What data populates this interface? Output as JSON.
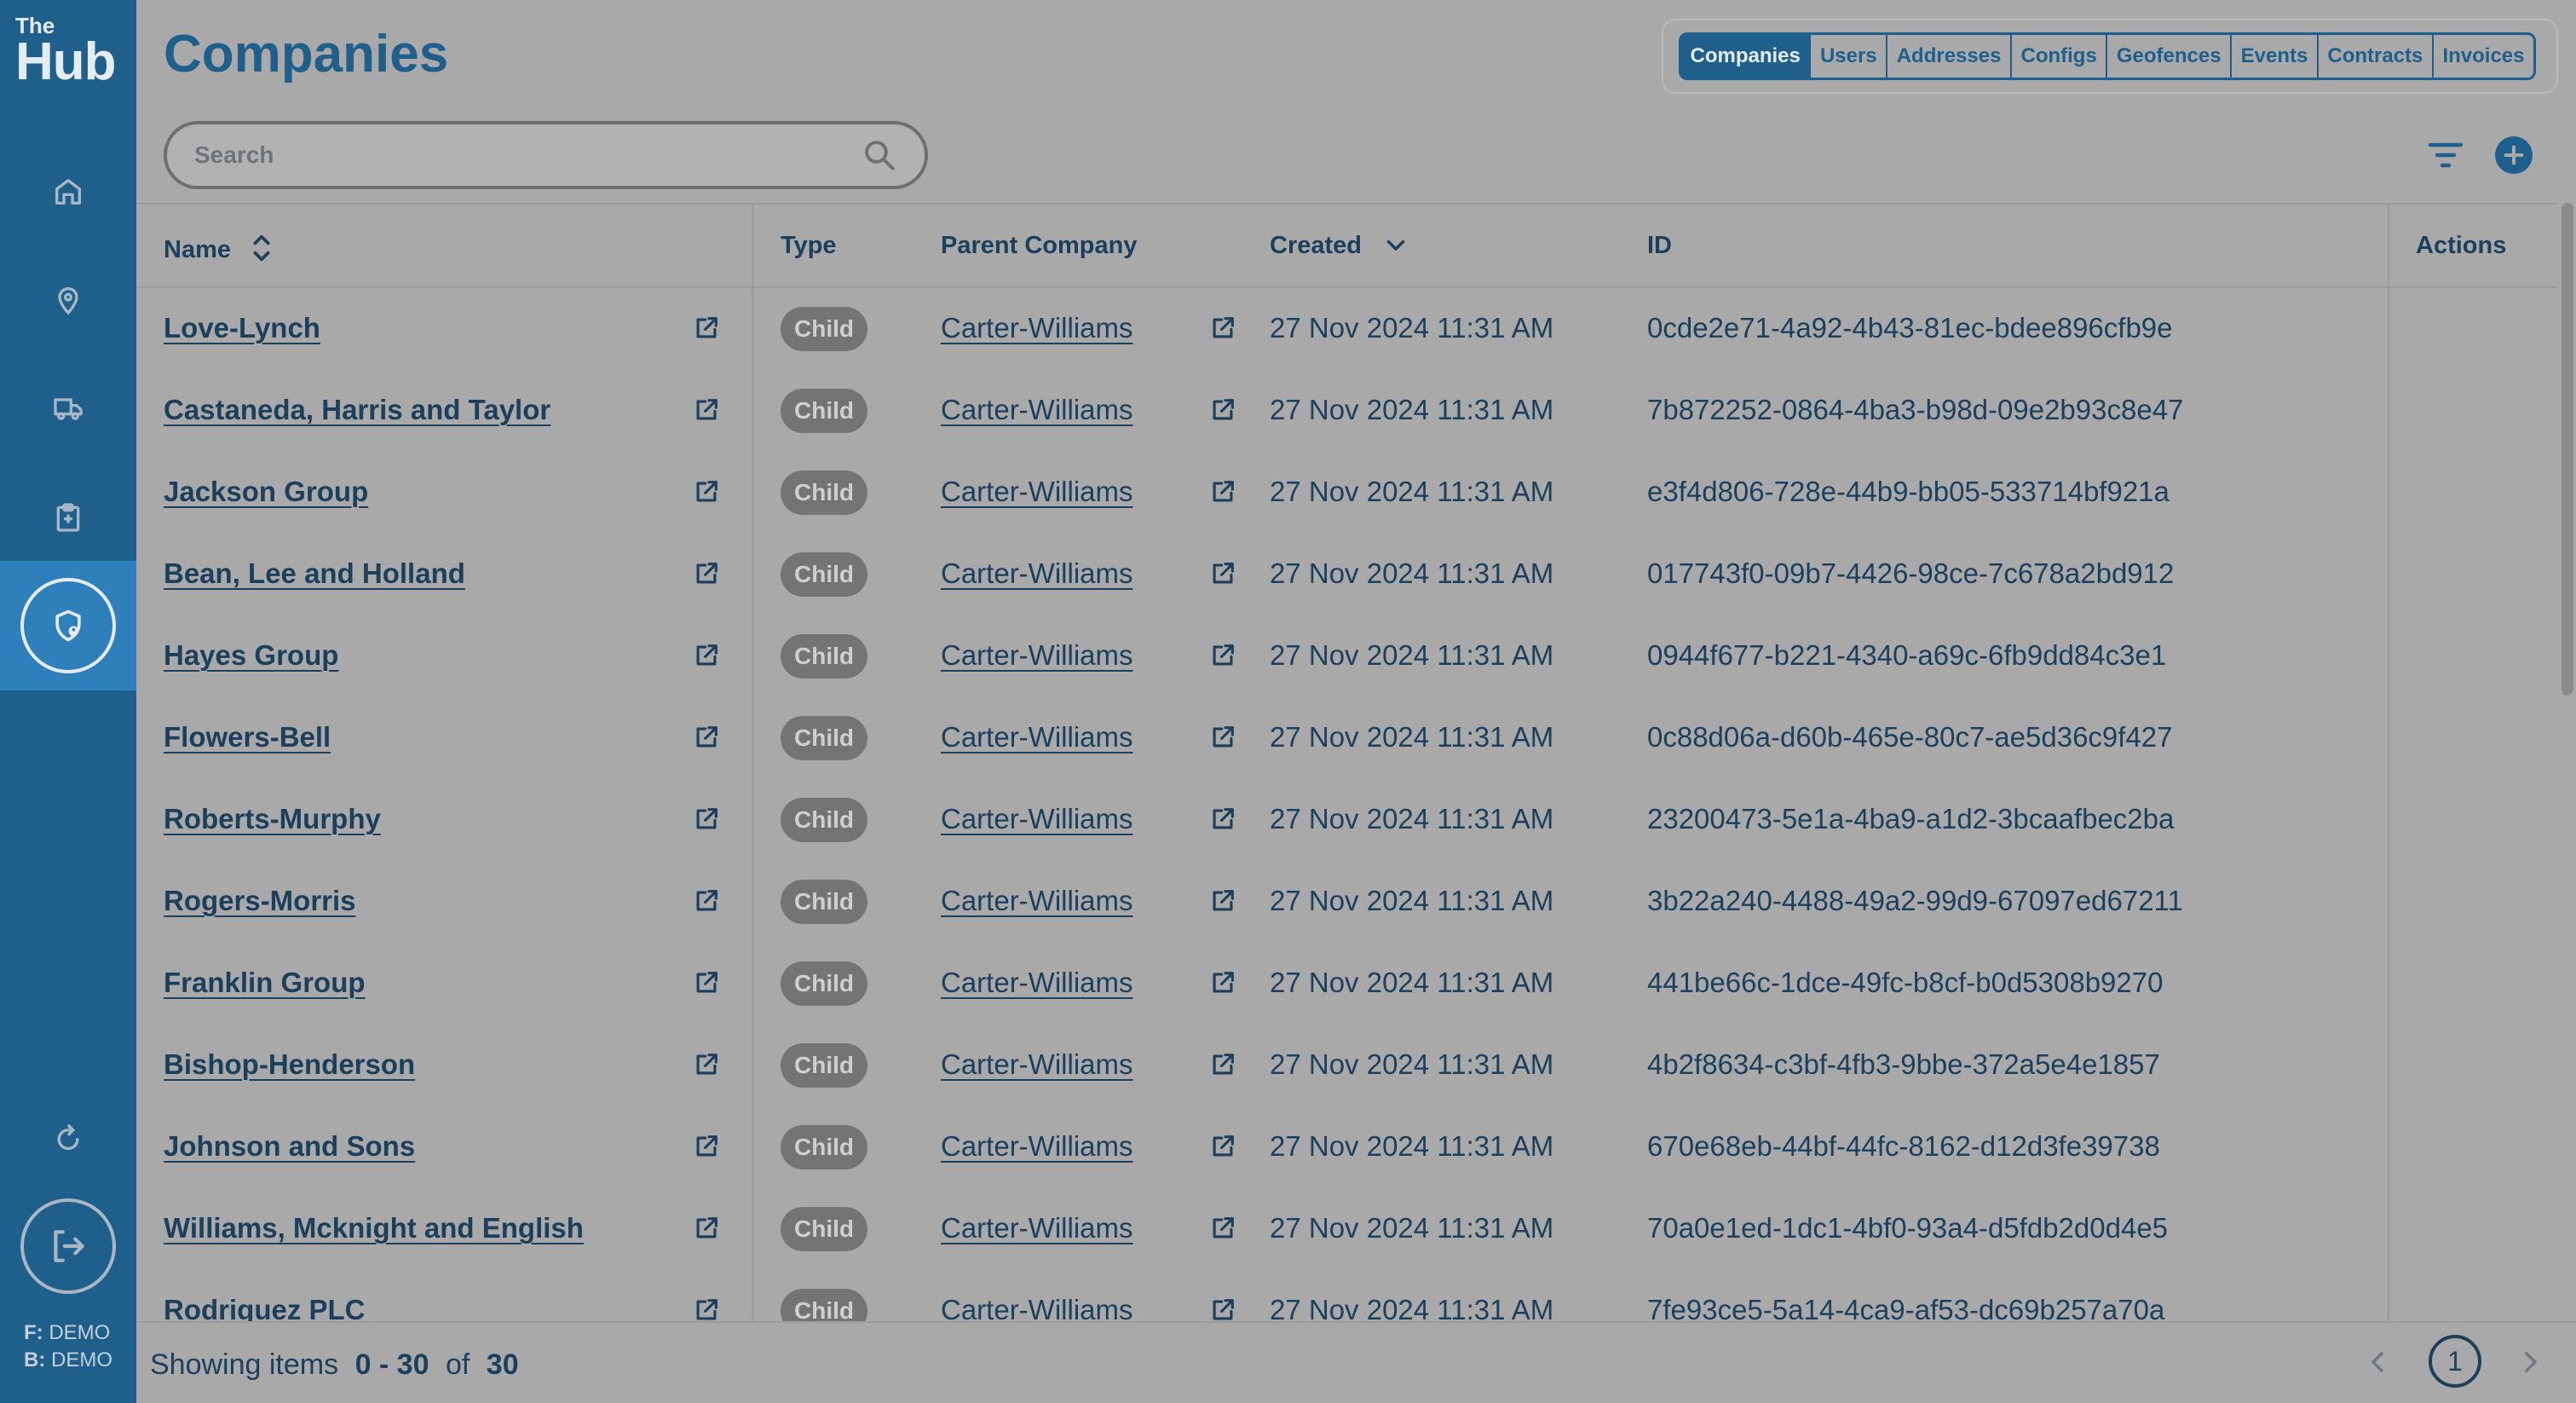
{
  "app": {
    "logo_top": "The",
    "logo_main": "Hub",
    "env_f_label": "F:",
    "env_f_value": "DEMO",
    "env_b_label": "B:",
    "env_b_value": "DEMO"
  },
  "header": {
    "title": "Companies",
    "tabs": [
      "Companies",
      "Users",
      "Addresses",
      "Configs",
      "Geofences",
      "Events",
      "Contracts",
      "Invoices"
    ],
    "active_tab": "Companies"
  },
  "search": {
    "placeholder": "Search",
    "value": ""
  },
  "table": {
    "columns": {
      "name": "Name",
      "type": "Type",
      "parent": "Parent Company",
      "created": "Created",
      "id": "ID",
      "actions": "Actions"
    },
    "rows": [
      {
        "name": "Love-Lynch",
        "type": "Child",
        "parent": "Carter-Williams",
        "created": "27 Nov 2024 11:31 AM",
        "id": "0cde2e71-4a92-4b43-81ec-bdee896cfb9e"
      },
      {
        "name": "Castaneda, Harris and Taylor",
        "type": "Child",
        "parent": "Carter-Williams",
        "created": "27 Nov 2024 11:31 AM",
        "id": "7b872252-0864-4ba3-b98d-09e2b93c8e47"
      },
      {
        "name": "Jackson Group",
        "type": "Child",
        "parent": "Carter-Williams",
        "created": "27 Nov 2024 11:31 AM",
        "id": "e3f4d806-728e-44b9-bb05-533714bf921a"
      },
      {
        "name": "Bean, Lee and Holland",
        "type": "Child",
        "parent": "Carter-Williams",
        "created": "27 Nov 2024 11:31 AM",
        "id": "017743f0-09b7-4426-98ce-7c678a2bd912"
      },
      {
        "name": "Hayes Group",
        "type": "Child",
        "parent": "Carter-Williams",
        "created": "27 Nov 2024 11:31 AM",
        "id": "0944f677-b221-4340-a69c-6fb9dd84c3e1"
      },
      {
        "name": "Flowers-Bell",
        "type": "Child",
        "parent": "Carter-Williams",
        "created": "27 Nov 2024 11:31 AM",
        "id": "0c88d06a-d60b-465e-80c7-ae5d36c9f427"
      },
      {
        "name": "Roberts-Murphy",
        "type": "Child",
        "parent": "Carter-Williams",
        "created": "27 Nov 2024 11:31 AM",
        "id": "23200473-5e1a-4ba9-a1d2-3bcaafbec2ba"
      },
      {
        "name": "Rogers-Morris",
        "type": "Child",
        "parent": "Carter-Williams",
        "created": "27 Nov 2024 11:31 AM",
        "id": "3b22a240-4488-49a2-99d9-67097ed67211"
      },
      {
        "name": "Franklin Group",
        "type": "Child",
        "parent": "Carter-Williams",
        "created": "27 Nov 2024 11:31 AM",
        "id": "441be66c-1dce-49fc-b8cf-b0d5308b9270"
      },
      {
        "name": "Bishop-Henderson",
        "type": "Child",
        "parent": "Carter-Williams",
        "created": "27 Nov 2024 11:31 AM",
        "id": "4b2f8634-c3bf-4fb3-9bbe-372a5e4e1857"
      },
      {
        "name": "Johnson and Sons",
        "type": "Child",
        "parent": "Carter-Williams",
        "created": "27 Nov 2024 11:31 AM",
        "id": "670e68eb-44bf-44fc-8162-d12d3fe39738"
      },
      {
        "name": "Williams, Mcknight and English",
        "type": "Child",
        "parent": "Carter-Williams",
        "created": "27 Nov 2024 11:31 AM",
        "id": "70a0e1ed-1dc1-4bf0-93a4-d5fdb2d0d4e5"
      },
      {
        "name": "Rodriguez PLC",
        "type": "Child",
        "parent": "Carter-Williams",
        "created": "27 Nov 2024 11:31 AM",
        "id": "7fe93ce5-5a14-4ca9-af53-dc69b257a70a"
      }
    ]
  },
  "footer": {
    "showing_prefix": "Showing items",
    "range": "0 - 30",
    "of_label": "of",
    "total": "30",
    "current_page": "1"
  },
  "colors": {
    "sidebar": "#1f5f8b",
    "accent": "#1f5f8b",
    "overlay_bg": "#a9a9a9"
  }
}
